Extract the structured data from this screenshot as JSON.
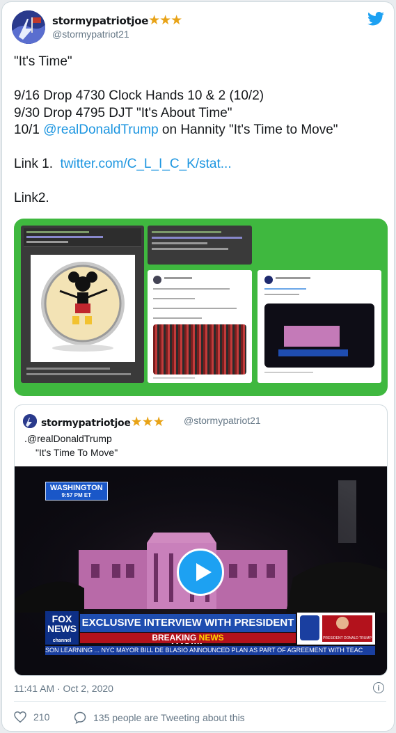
{
  "author": {
    "name": "stormypatriotjoe",
    "stars": "★★★",
    "handle": "@stormypatriot21"
  },
  "tweet": {
    "line1": "\"It's Time\"",
    "line2": "9/16 Drop 4730 Clock Hands 10 & 2 (10/2)",
    "line3": "9/30 Drop 4795 DJT \"It's About Time\"",
    "line4_prefix": "10/1 ",
    "line4_mention": "@realDonaldTrump",
    "line4_suffix": " on Hannity \"It's Time to Move\"",
    "link1_label": "Link 1.  ",
    "link1_url": "twitter.com/C_L_I_C_K/stat...",
    "link2_label": "Link2."
  },
  "quoted": {
    "name": "stormypatriotjoe",
    "stars": "★★★",
    "handle": "@stormypatriot21",
    "line1": ".@realDonaldTrump",
    "line2": "\"It's Time To Move\"",
    "video": {
      "location": "WASHINGTON",
      "time": "9:57 PM ET",
      "network_top": "FOX",
      "network_mid": "NEWS",
      "network_bot": "channel",
      "headline": "EXCLUSIVE INTERVIEW WITH PRESIDENT TRUMP",
      "breaking_1": "BREAKING ",
      "breaking_2": "NEWS",
      "ticker": "SON LEARNING ...   NYC MAYOR BILL DE BLASIO ANNOUNCED PLAN AS PART OF AGREEMENT WITH TEAC",
      "inset_caption": "PRESIDENT DONALD TRUMP"
    }
  },
  "meta": {
    "timestamp": "11:41 AM · Oct 2, 2020",
    "likes": "210",
    "tweeting": "135 people are Tweeting about this"
  },
  "colors": {
    "link": "#1b95e0",
    "star": "#e8a317",
    "media_bg": "#3fb83f",
    "play": "#1da1f2"
  }
}
